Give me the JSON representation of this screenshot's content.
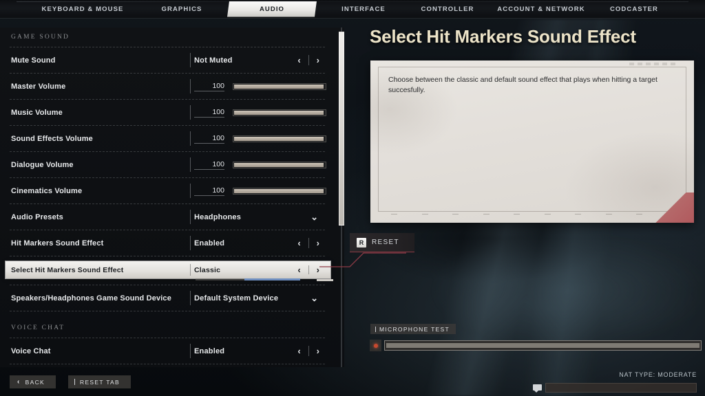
{
  "tabs": [
    {
      "label": "KEYBOARD & MOUSE",
      "active": false
    },
    {
      "label": "GRAPHICS",
      "active": false
    },
    {
      "label": "AUDIO",
      "active": true
    },
    {
      "label": "INTERFACE",
      "active": false
    },
    {
      "label": "CONTROLLER",
      "active": false
    },
    {
      "label": "ACCOUNT & NETWORK",
      "active": false
    },
    {
      "label": "CODCASTER",
      "active": false
    }
  ],
  "settings": {
    "group_game_sound": "GAME SOUND",
    "group_voice_chat": "VOICE CHAT",
    "rows": [
      {
        "label": "Mute Sound",
        "value": "Not Muted",
        "type": "stepper"
      },
      {
        "label": "Master Volume",
        "value": "100",
        "type": "slider",
        "percent": 100
      },
      {
        "label": "Music Volume",
        "value": "100",
        "type": "slider",
        "percent": 100
      },
      {
        "label": "Sound Effects Volume",
        "value": "100",
        "type": "slider",
        "percent": 100
      },
      {
        "label": "Dialogue Volume",
        "value": "100",
        "type": "slider",
        "percent": 100
      },
      {
        "label": "Cinematics Volume",
        "value": "100",
        "type": "slider",
        "percent": 100
      },
      {
        "label": "Audio Presets",
        "value": "Headphones",
        "type": "dropdown"
      },
      {
        "label": "Hit Markers Sound Effect",
        "value": "Enabled",
        "type": "stepper"
      },
      {
        "label": "Select Hit Markers Sound Effect",
        "value": "Classic",
        "type": "stepper",
        "selected": true
      },
      {
        "label": "Speakers/Headphones Game Sound Device",
        "value": "Default System Device",
        "type": "dropdown"
      },
      {
        "label": "Voice Chat",
        "value": "Enabled",
        "type": "stepper"
      }
    ],
    "arrow_left": "‹",
    "arrow_right": "›",
    "chevron_down": "⌄"
  },
  "detail": {
    "title": "Select Hit Markers Sound Effect",
    "description": "Choose between the classic and default sound effect that plays when hitting a target succesfully."
  },
  "reset_hint": {
    "key": "R",
    "label": "RESET"
  },
  "mic": {
    "tag": "MICROPHONE TEST"
  },
  "bottom": {
    "back_label": "BACK",
    "back_arrow": "‹",
    "reset_tab_label": "RESET TAB",
    "nat_type": "NAT TYPE: MODERATE"
  },
  "colors": {
    "accent_title": "#ece3c8",
    "selected_bg": "#f3f2ef",
    "progress_blue": "#6e8ec0",
    "reset_underline": "#8e3b46",
    "record_dot": "#c8492f"
  }
}
